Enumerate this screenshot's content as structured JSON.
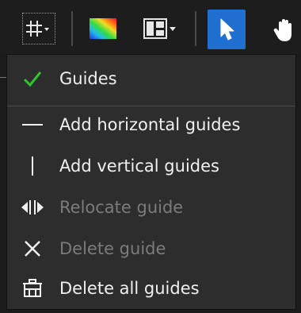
{
  "toolbar": {
    "buttons": [
      {
        "name": "guides-menu-button",
        "icon": "grid-hash-icon"
      },
      {
        "name": "color-map-button",
        "icon": "color-gradient-icon"
      },
      {
        "name": "layout-button",
        "icon": "layout-panels-icon"
      },
      {
        "name": "pointer-tool-button",
        "icon": "pointer-arrow-icon",
        "active": true
      },
      {
        "name": "pan-tool-button",
        "icon": "hand-icon"
      }
    ],
    "accent_color": "#1f6fd1"
  },
  "menu": {
    "items": [
      {
        "label": "Guides",
        "icon": "checkmark-icon",
        "checked": true,
        "enabled": true
      },
      {
        "label": "Add horizontal guides",
        "icon": "horizontal-line-icon",
        "enabled": true
      },
      {
        "label": "Add vertical guides",
        "icon": "vertical-line-icon",
        "enabled": true
      },
      {
        "label": "Relocate guide",
        "icon": "relocate-arrows-icon",
        "enabled": false
      },
      {
        "label": "Delete guide",
        "icon": "x-icon",
        "enabled": false
      },
      {
        "label": "Delete all guides",
        "icon": "trash-icon",
        "enabled": true
      }
    ],
    "check_color": "#2ec52e"
  }
}
